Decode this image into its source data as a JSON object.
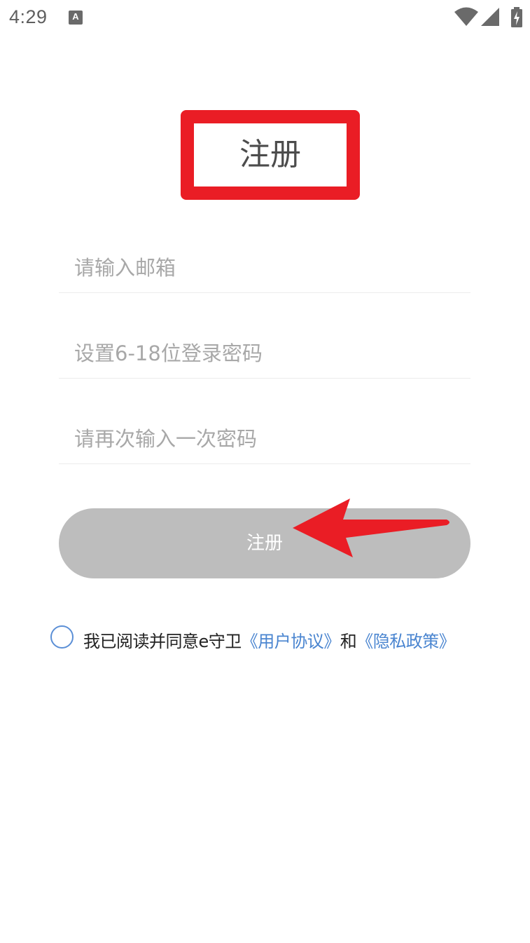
{
  "status_bar": {
    "time": "4:29",
    "notification_icon_letter": "A",
    "icons": [
      "wifi-icon",
      "signal-icon",
      "battery-charging-icon"
    ]
  },
  "page": {
    "title": "注册",
    "annotation_color": "#ea1d25"
  },
  "form": {
    "email_placeholder": "请输入邮箱",
    "email_value": "",
    "password_placeholder": "设置6-18位登录密码",
    "password_value": "",
    "confirm_placeholder": "请再次输入一次密码",
    "confirm_value": "",
    "submit_label": "注册",
    "submit_color": "#bdbdbd"
  },
  "agreement": {
    "checked": false,
    "prefix": "我已阅读并同意e守卫",
    "user_agreement_link": "《用户协议》",
    "conjunction": "和",
    "privacy_policy_link": "《隐私政策》",
    "link_color": "#4a85d0"
  }
}
